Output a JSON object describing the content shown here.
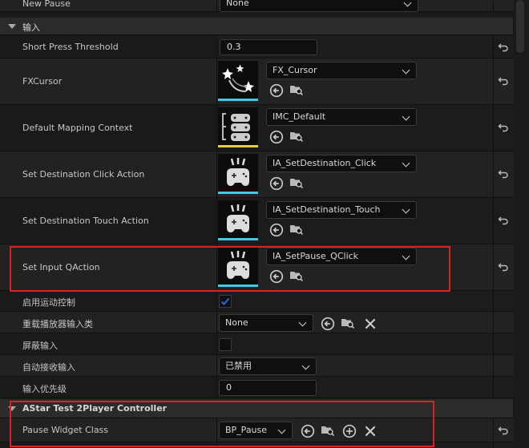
{
  "rows": {
    "new_pause": {
      "label": "New Pause",
      "value": "None"
    },
    "short_press": {
      "label": "Short Press Threshold",
      "value": "0.3"
    },
    "fx_cursor": {
      "label": "FXCursor",
      "value": "FX_Cursor"
    },
    "mapping_context": {
      "label": "Default Mapping Context",
      "value": "IMC_Default"
    },
    "dest_click": {
      "label": "Set Destination Click Action",
      "value": "IA_SetDestination_Click"
    },
    "dest_touch": {
      "label": "Set Destination Touch Action",
      "value": "IA_SetDestination_Touch"
    },
    "input_q": {
      "label": "Set Input QAction",
      "value": "IA_SetPause_QClick"
    },
    "motion_ctrl": {
      "label": "启用运动控制",
      "checked": true
    },
    "override_player": {
      "label": "重载播放器输入类",
      "value": "None"
    },
    "block_input": {
      "label": "屏蔽输入",
      "checked": false
    },
    "auto_receive": {
      "label": "自动接收输入",
      "value": "已禁用"
    },
    "input_priority": {
      "label": "输入优先级",
      "value": "0"
    },
    "pause_widget": {
      "label": "Pause Widget Class",
      "value": "BP_Pause"
    }
  },
  "sections": {
    "input": "输入",
    "astar": "AStar Test 2Player Controller"
  },
  "icons": {
    "reset": "reset-arrow-icon",
    "use": "use-selected-arrow-icon",
    "browse": "browse-folder-icon",
    "add": "add-circle-icon",
    "clear": "clear-x-icon"
  },
  "colors": {
    "highlight": "#d9231f",
    "thumb_cyan": "#41c8e8",
    "thumb_yellow": "#e0cf3a",
    "checkmark": "#1e6fe0"
  }
}
